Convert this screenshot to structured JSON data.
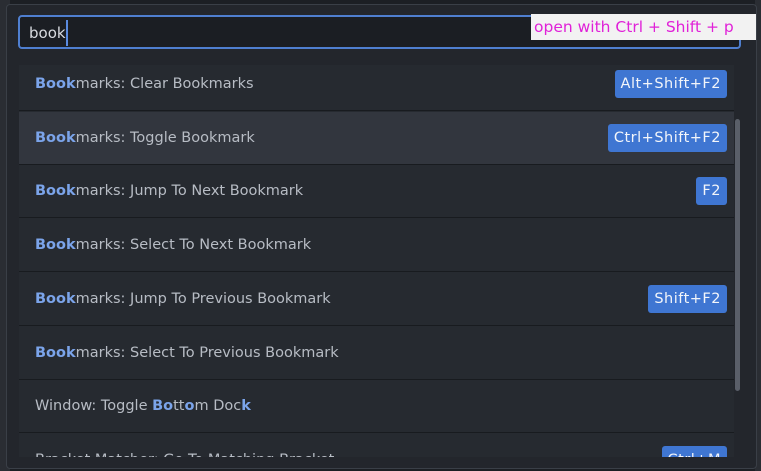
{
  "search": {
    "query": "book",
    "hint": "open with Ctrl + Shift + p"
  },
  "rows": [
    {
      "parts": [
        {
          "t": "Book",
          "h": true
        },
        {
          "t": "marks: Clear Bookmarks",
          "h": false
        }
      ],
      "shortcut": "Alt+Shift+F2",
      "selected": false
    },
    {
      "parts": [
        {
          "t": "Book",
          "h": true
        },
        {
          "t": "marks: Toggle Bookmark",
          "h": false
        }
      ],
      "shortcut": "Ctrl+Shift+F2",
      "selected": true
    },
    {
      "parts": [
        {
          "t": "Book",
          "h": true
        },
        {
          "t": "marks: Jump To Next Bookmark",
          "h": false
        }
      ],
      "shortcut": "F2",
      "selected": false
    },
    {
      "parts": [
        {
          "t": "Book",
          "h": true
        },
        {
          "t": "marks: Select To Next Bookmark",
          "h": false
        }
      ],
      "shortcut": "",
      "selected": false
    },
    {
      "parts": [
        {
          "t": "Book",
          "h": true
        },
        {
          "t": "marks: Jump To Previous Bookmark",
          "h": false
        }
      ],
      "shortcut": "Shift+F2",
      "selected": false
    },
    {
      "parts": [
        {
          "t": "Book",
          "h": true
        },
        {
          "t": "marks: Select To Previous Bookmark",
          "h": false
        }
      ],
      "shortcut": "",
      "selected": false
    },
    {
      "parts": [
        {
          "t": "Window: Toggle ",
          "h": false
        },
        {
          "t": "Bo",
          "h": true
        },
        {
          "t": "tt",
          "h": false
        },
        {
          "t": "o",
          "h": true
        },
        {
          "t": "m Doc",
          "h": false
        },
        {
          "t": "k",
          "h": true
        }
      ],
      "shortcut": "",
      "selected": false
    },
    {
      "parts": [
        {
          "t": "Bracket Matcher: Go To Matching Bracket",
          "h": false
        }
      ],
      "shortcut": "Ctrl+M",
      "selected": false
    }
  ],
  "colors": {
    "accent": "#3f76d2",
    "highlight": "#7ba4ea",
    "hint_text": "#e021d8"
  }
}
